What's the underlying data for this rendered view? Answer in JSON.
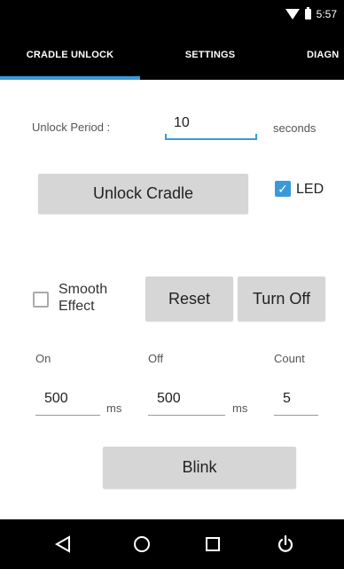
{
  "status_bar": {
    "time": "5:57",
    "icons": [
      "wifi-icon",
      "battery-icon"
    ]
  },
  "tabs": [
    {
      "label": "CRADLE UNLOCK",
      "selected": true
    },
    {
      "label": "SETTINGS",
      "selected": false
    },
    {
      "label": "DIAGN",
      "selected": false
    }
  ],
  "unlock": {
    "period_label": "Unlock Period :",
    "period_value": "10",
    "period_unit": "seconds",
    "unlock_button": "Unlock Cradle",
    "led_label": "LED",
    "led_checked": true
  },
  "effects": {
    "smooth_label_line1": "Smooth",
    "smooth_label_line2": "Effect",
    "smooth_checked": false,
    "reset_button": "Reset",
    "turn_off_button": "Turn Off"
  },
  "blink": {
    "on_label": "On",
    "off_label": "Off",
    "count_label": "Count",
    "on_value": "500",
    "off_value": "500",
    "count_value": "5",
    "on_unit": "ms",
    "off_unit": "ms",
    "blink_button": "Blink"
  },
  "nav": [
    "back-icon",
    "home-icon",
    "recents-icon",
    "power-icon"
  ],
  "colors": {
    "accent": "#3a9ad9",
    "bar": "#000000",
    "button": "#d6d6d6"
  }
}
